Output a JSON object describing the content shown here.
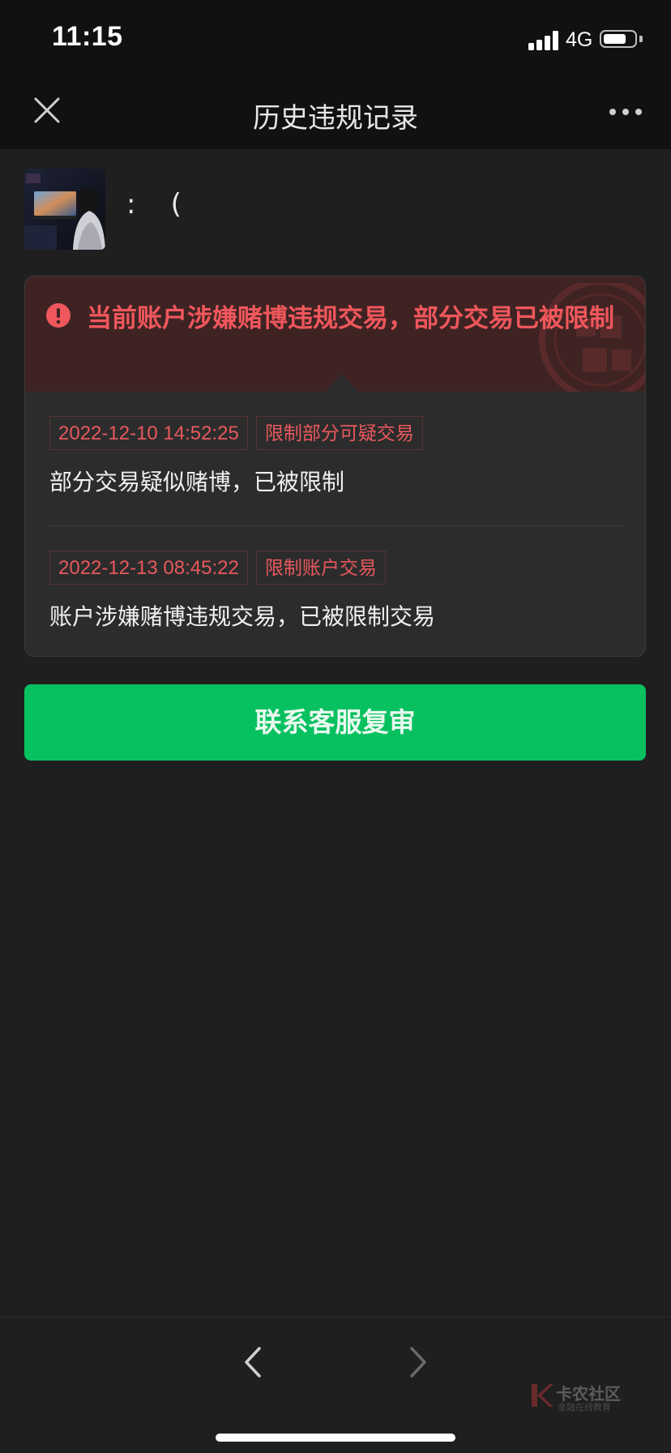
{
  "status_bar": {
    "time": "11:15",
    "network": "4G",
    "signal_bars": 4,
    "battery_level": 0.75
  },
  "nav": {
    "title": "历史违规记录",
    "close_icon": "close-icon",
    "more_icon": "more-icon"
  },
  "user": {
    "name": ":    (",
    "avatar_icon": "avatar"
  },
  "alert": {
    "icon": "exclamation-icon",
    "message": "当前账户涉嫌赌博违规交易，部分交易已被限制"
  },
  "records": [
    {
      "date": "2022-12-10 14:52:25",
      "tag": "限制部分可疑交易",
      "description": "部分交易疑似赌博，已被限制"
    },
    {
      "date": "2022-12-13 08:45:22",
      "tag": "限制账户交易",
      "description": "账户涉嫌赌博违规交易，已被限制交易"
    }
  ],
  "actions": {
    "appeal_label": "联系客服复审"
  },
  "bottom_bar": {
    "back_icon": "chevron-left-icon",
    "forward_icon": "chevron-right-icon"
  },
  "watermark": {
    "title": "卡农社区",
    "subtitle": "金融在线教育"
  },
  "colors": {
    "accent_green": "#07c160",
    "alert_red": "#f0575c",
    "background": "#1f1f1f",
    "card": "#2c2c2c"
  }
}
